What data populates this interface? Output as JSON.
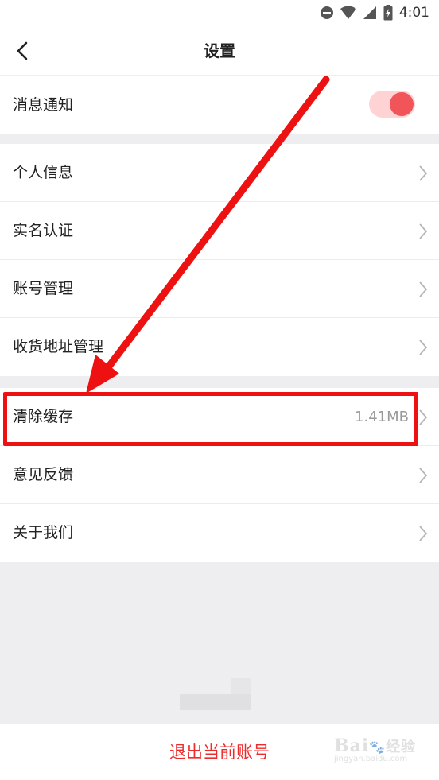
{
  "status_bar": {
    "time": "4:01",
    "icons": [
      "dnd-icon",
      "wifi-icon",
      "signal-icon",
      "battery-charging-icon"
    ]
  },
  "header": {
    "back_icon": "chevron-left-icon",
    "title": "设置"
  },
  "notification": {
    "label": "消息通知",
    "enabled": true,
    "toggle_color": "#f25559"
  },
  "account_group": {
    "items": [
      {
        "label": "个人信息"
      },
      {
        "label": "实名认证"
      },
      {
        "label": "账号管理"
      },
      {
        "label": "收货地址管理"
      }
    ]
  },
  "misc_group": {
    "items": [
      {
        "label": "清除缓存",
        "value": "1.41MB"
      },
      {
        "label": "意见反馈"
      },
      {
        "label": "关于我们"
      }
    ]
  },
  "logout": {
    "label": "退出当前账号",
    "color": "#ee2b2b"
  },
  "annotation": {
    "color": "#ee1111"
  },
  "watermark": {
    "main": "Bai",
    "suffix": "经验",
    "sub": "jingyan.baidu.com"
  }
}
